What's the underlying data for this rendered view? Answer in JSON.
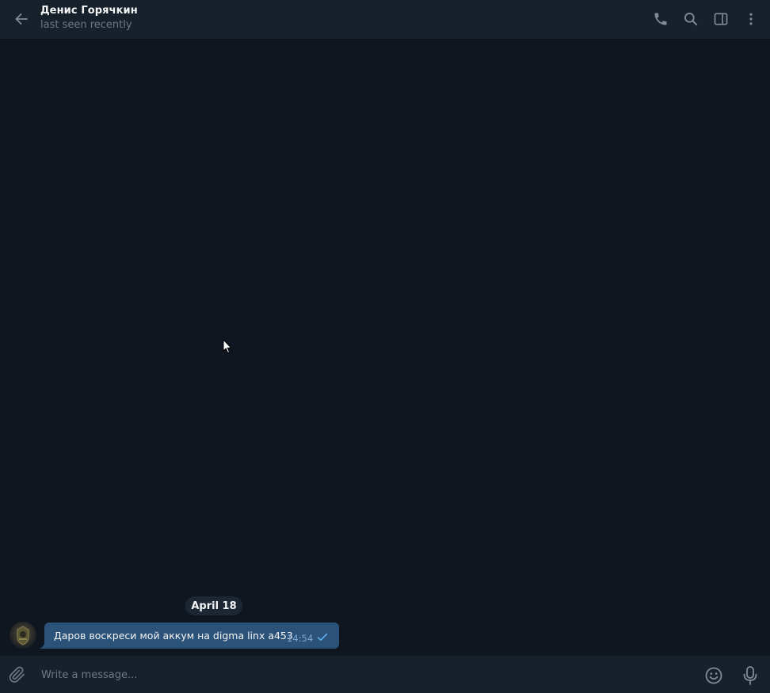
{
  "header": {
    "contact_name": "Денис Горячкин",
    "status": "last seen recently",
    "icons": [
      "back-arrow-icon",
      "phone-icon",
      "search-icon",
      "sidebar-toggle-icon",
      "more-vertical-icon"
    ]
  },
  "chat": {
    "date_separator": "April 18",
    "messages": [
      {
        "text": "Даров воскреси мой аккум на digma linx a453",
        "time": "14:54",
        "status_icon": "single-check-icon"
      }
    ]
  },
  "composer": {
    "placeholder": "Write a message...",
    "icons": [
      "paperclip-icon",
      "emoji-icon",
      "microphone-icon"
    ]
  },
  "colors": {
    "header_bg": "#17212b",
    "chat_bg": "#0f1620",
    "bubble_bg": "#2b5278",
    "accent": "#5eb5f7",
    "muted_text": "#6d7883"
  }
}
